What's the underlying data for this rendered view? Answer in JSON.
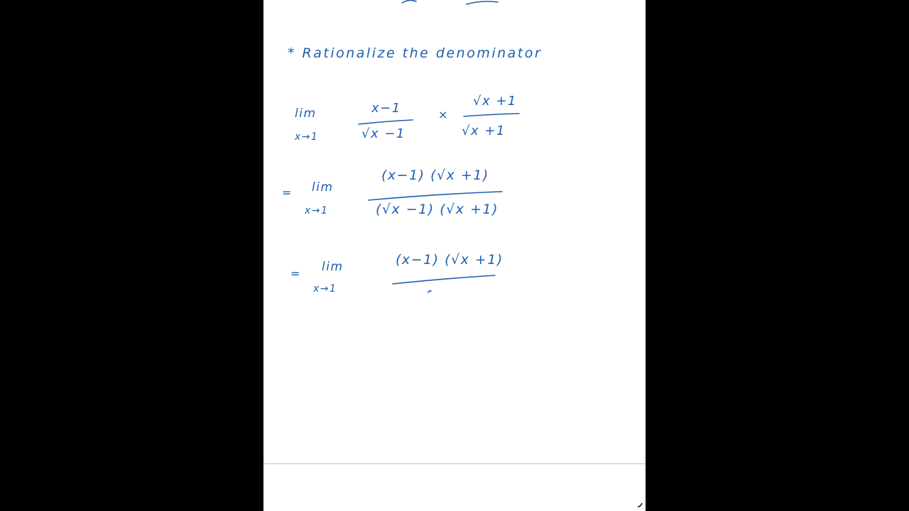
{
  "notes": {
    "heading": "* Rationalize the denominator",
    "line1": {
      "lim": "lim",
      "sub": "x→1",
      "frac1_num": "x−1",
      "frac1_den": "√x −1",
      "times": "×",
      "frac2_num": "√x +1",
      "frac2_den": "√x +1"
    },
    "line2": {
      "eq": "=",
      "lim": "lim",
      "sub": "x→1",
      "num": "(x−1) (√x +1)",
      "den": "(√x −1) (√x +1)"
    },
    "line3": {
      "eq": "=",
      "lim": "lim",
      "sub": "x→1",
      "num": "(x−1) (√x +1)"
    }
  },
  "toolbar": {
    "back_icon": "arrow-left-icon",
    "pen_tools": [
      "pen-icon",
      "highlighter-icon",
      "pencil-icon",
      "eraser-icon",
      "text-icon",
      "lasso-icon",
      "add-icon",
      "microphone-icon",
      "shape-icon",
      "chevron-right-icon"
    ],
    "actions": [
      "undo-icon",
      "redo-icon",
      "more-icon",
      "export-icon",
      "pages-icon"
    ]
  },
  "colors": {
    "ink": "#1d5fae",
    "toolbar_bg": "#151515",
    "active_tool": "#6fa3ff",
    "page_bg": "#ffffff"
  }
}
